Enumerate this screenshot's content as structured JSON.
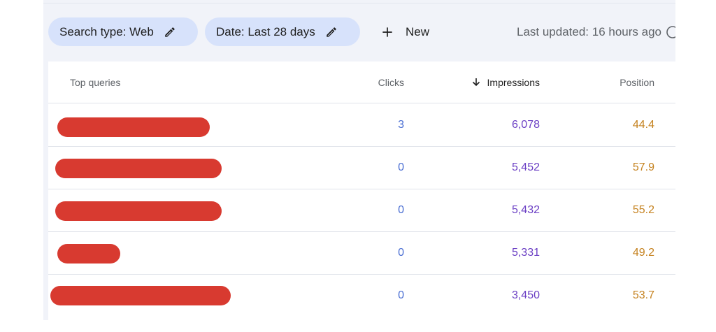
{
  "filters": {
    "search_type": "Search type: Web",
    "date": "Date: Last 28 days",
    "new_label": "New",
    "last_updated": "Last updated: 16 hours ago"
  },
  "table": {
    "columns": {
      "query": "Top queries",
      "clicks": "Clicks",
      "impressions": "Impressions",
      "position": "Position"
    },
    "sort": {
      "column": "impressions",
      "direction": "descending"
    },
    "rows": [
      {
        "query_redacted": true,
        "clicks": "3",
        "impressions": "6,078",
        "position": "44.4"
      },
      {
        "query_redacted": true,
        "clicks": "0",
        "impressions": "5,452",
        "position": "57.9"
      },
      {
        "query_redacted": true,
        "clicks": "0",
        "impressions": "5,432",
        "position": "55.2"
      },
      {
        "query_redacted": true,
        "clicks": "0",
        "impressions": "5,331",
        "position": "49.2"
      },
      {
        "query_redacted": true,
        "clicks": "0",
        "impressions": "3,450",
        "position": "53.7"
      }
    ]
  },
  "colors": {
    "chip_bg": "#d7e2fb",
    "redaction": "#d83a30",
    "clicks": "#4b6fd3",
    "impressions": "#6b3fc4",
    "position": "#c5821f"
  }
}
